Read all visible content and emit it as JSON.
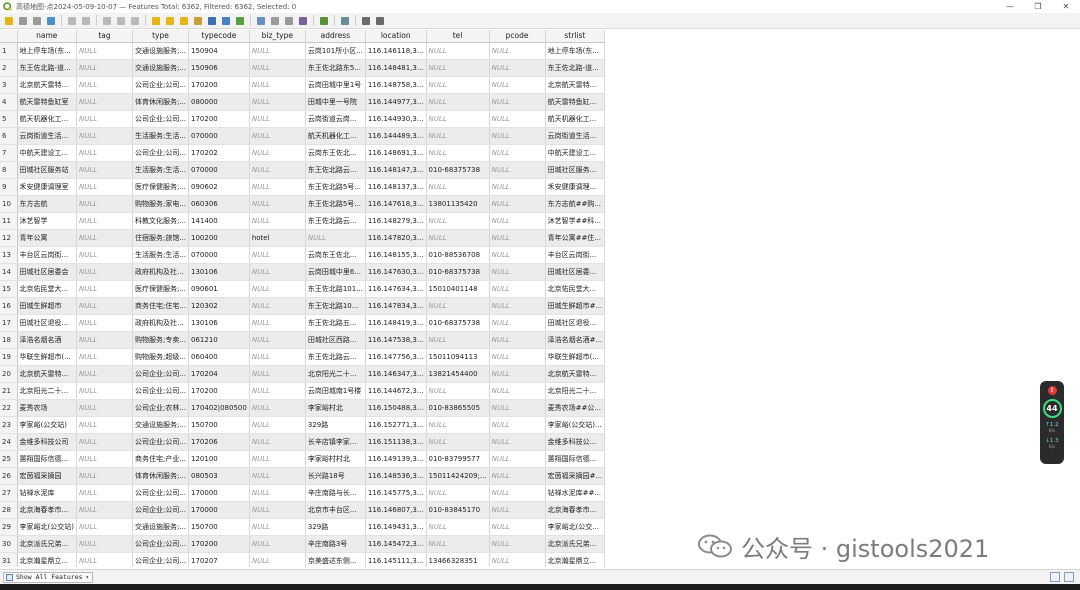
{
  "window": {
    "title": "高德地图-点2024-05-09-10-07 — Features Total: 6362, Filtered: 6362, Selected: 0",
    "min_glyph": "—",
    "max_glyph": "❐",
    "close_glyph": "✕"
  },
  "toolbar": {
    "icons": [
      "toggle-editing-icon",
      "multi-edit-icon",
      "save-edits-icon",
      "reload-icon",
      "add-feature-icon",
      "delete-selected-icon",
      "cut-icon",
      "copy-icon",
      "paste-icon",
      "select-expression-icon",
      "select-all-icon",
      "invert-selection-icon",
      "deselect-icon",
      "filter-select-icon",
      "move-selection-top-icon",
      "pan-to-selection-icon",
      "zoom-to-selection-icon",
      "new-field-icon",
      "delete-field-icon",
      "field-calculator-icon",
      "conditional-formatting-icon",
      "actions-icon",
      "dock-icon",
      "organize-columns-icon"
    ]
  },
  "table": {
    "columns": [
      "name",
      "tag",
      "type",
      "typecode",
      "biz_type",
      "address",
      "location",
      "tel",
      "pcode",
      "strlist"
    ],
    "rows": [
      [
        "1",
        "地上停车场(东...",
        "NULL",
        "交通设施服务;...",
        "150904",
        "NULL",
        "云岗101所小区...",
        "116.146118,3...",
        "NULL",
        "NULL",
        "地上停车场(东..."
      ],
      [
        "2",
        "东王佐北路-道...",
        "NULL",
        "交通设施服务;...",
        "150906",
        "NULL",
        "东王佐北路东5...",
        "116.148481,3...",
        "NULL",
        "NULL",
        "东王佐北路-道..."
      ],
      [
        "3",
        "北京航天雷特...",
        "NULL",
        "公司企业;公司...",
        "170200",
        "NULL",
        "云岗田城中里1号",
        "116.148758,3...",
        "NULL",
        "NULL",
        "北京航天雷特..."
      ],
      [
        "4",
        "航天雷特鱼缸室",
        "NULL",
        "体育休闲服务;...",
        "080000",
        "NULL",
        "田城中里一号院",
        "116.144977,3...",
        "NULL",
        "NULL",
        "航天雷特鱼缸..."
      ],
      [
        "5",
        "航天机器化工...",
        "NULL",
        "公司企业;公司...",
        "170200",
        "NULL",
        "云岗街道云岗...",
        "116.144930,3...",
        "NULL",
        "NULL",
        "航天机器化工..."
      ],
      [
        "6",
        "云岗街道生活...",
        "NULL",
        "生活服务;生活...",
        "070000",
        "NULL",
        "航天机器化工...",
        "116.144489,3...",
        "NULL",
        "NULL",
        "云岗街道生活..."
      ],
      [
        "7",
        "中航天建设工...",
        "NULL",
        "公司企业;公司...",
        "170202",
        "NULL",
        "云岗东王佐北...",
        "116.148691,3...",
        "NULL",
        "NULL",
        "中航天建设工..."
      ],
      [
        "8",
        "田城社区服务站",
        "NULL",
        "生活服务;生活...",
        "070000",
        "NULL",
        "东王佐北路云...",
        "116.148147,3...",
        "010-68375738",
        "NULL",
        "田城社区服务..."
      ],
      [
        "9",
        "禾安健康调理室",
        "NULL",
        "医疗保健服务;...",
        "090602",
        "NULL",
        "东王佐北路5号...",
        "116.148137,3...",
        "NULL",
        "NULL",
        "禾安健康调理..."
      ],
      [
        "10",
        "东方志航",
        "NULL",
        "购物服务;家电...",
        "060306",
        "NULL",
        "东王佐北路5号...",
        "116.147618,3...",
        "13801135420",
        "NULL",
        "东方志航##购..."
      ],
      [
        "11",
        "沐艺智学",
        "NULL",
        "科教文化服务;...",
        "141400",
        "NULL",
        "东王佐北路云...",
        "116.148279,3...",
        "NULL",
        "NULL",
        "沐艺智学##科..."
      ],
      [
        "12",
        "青年公寓",
        "NULL",
        "住宿服务;旅馆...",
        "100200",
        "hotel",
        "NULL",
        "116.147820,3...",
        "NULL",
        "NULL",
        "青年公寓##住..."
      ],
      [
        "13",
        "丰台区云岗街...",
        "NULL",
        "生活服务;生活...",
        "070000",
        "NULL",
        "云岗东王佐北...",
        "116.148155,3...",
        "010-88536708",
        "NULL",
        "丰台区云岗街..."
      ],
      [
        "14",
        "田城社区居委会",
        "NULL",
        "政府机构及社...",
        "130106",
        "NULL",
        "云岗田城中里6...",
        "116.147630,3...",
        "010-68375738",
        "NULL",
        "田城社区居委..."
      ],
      [
        "15",
        "北京佑民堂大...",
        "NULL",
        "医疗保健服务;...",
        "090601",
        "NULL",
        "东王佐北路101...",
        "116.147634,3...",
        "15010401148",
        "NULL",
        "北京佑民堂大..."
      ],
      [
        "16",
        "田城生鲜超市",
        "NULL",
        "商务住宅;住宅...",
        "120302",
        "NULL",
        "东王佐北路10...",
        "116.147834,3...",
        "NULL",
        "NULL",
        "田城生鲜超市#..."
      ],
      [
        "17",
        "田城社区退役...",
        "NULL",
        "政府机构及社...",
        "130106",
        "NULL",
        "东王佐北路五...",
        "116.148419,3...",
        "010-68375738",
        "NULL",
        "田城社区退役..."
      ],
      [
        "18",
        "泽浩名烟名酒",
        "NULL",
        "购物服务;专卖...",
        "061210",
        "NULL",
        "田城社区西路...",
        "116.147538,3...",
        "NULL",
        "NULL",
        "泽浩名烟名酒#..."
      ],
      [
        "19",
        "华联生鲜超市(...",
        "NULL",
        "购物服务;超级...",
        "060400",
        "NULL",
        "东王佐北路云...",
        "116.147756,3...",
        "15011094113",
        "NULL",
        "华联生鲜超市(..."
      ],
      [
        "20",
        "北京航天雷特...",
        "NULL",
        "公司企业;公司...",
        "170204",
        "NULL",
        "北京阳光二十...",
        "116.146347,3...",
        "13821454400",
        "NULL",
        "北京航天雷特..."
      ],
      [
        "21",
        "北京阳光二十...",
        "NULL",
        "公司企业;公司...",
        "170200",
        "NULL",
        "云岗田城南1号楼",
        "116.144672,3...",
        "NULL",
        "NULL",
        "北京阳光二十..."
      ],
      [
        "22",
        "麦秀农场",
        "NULL",
        "公司企业;农林...",
        "170402|080500",
        "NULL",
        "李家峪村北",
        "116.150488,3...",
        "010-83865505",
        "NULL",
        "麦秀农场##公..."
      ],
      [
        "23",
        "李家峪(公交站)",
        "NULL",
        "交通设施服务;...",
        "150700",
        "NULL",
        "329路",
        "116.152771,3...",
        "NULL",
        "NULL",
        "李家峪(公交站)..."
      ],
      [
        "24",
        "金维多科技公司",
        "NULL",
        "公司企业;公司...",
        "170206",
        "NULL",
        "长辛店镇李家...",
        "116.151138,3...",
        "NULL",
        "NULL",
        "金维多科技公..."
      ],
      [
        "25",
        "蕙翔国际信德...",
        "NULL",
        "商务住宅;产业...",
        "120100",
        "NULL",
        "李家峪村村北",
        "116.149139,3...",
        "010-83799577",
        "NULL",
        "蕙翔国际信德..."
      ],
      [
        "26",
        "宏茵福采摘园",
        "NULL",
        "体育休闲服务;...",
        "080503",
        "NULL",
        "长兴路18号",
        "116.148536,3...",
        "15011424209;...",
        "NULL",
        "宏茵福采摘园#..."
      ],
      [
        "27",
        "钻禅水泥库",
        "NULL",
        "公司企业;公司...",
        "170000",
        "NULL",
        "辛庄南路与长...",
        "116.145775,3...",
        "NULL",
        "NULL",
        "钻禅水泥库##..."
      ],
      [
        "28",
        "北京海春孝市...",
        "NULL",
        "公司企业;公司...",
        "170000",
        "NULL",
        "北京市丰台区...",
        "116.146807,3...",
        "010-83845170",
        "NULL",
        "北京海春孝市..."
      ],
      [
        "29",
        "李家峪北(公交站)",
        "NULL",
        "交通设施服务;...",
        "150700",
        "NULL",
        "329路",
        "116.149431,3...",
        "NULL",
        "NULL",
        "李家峪北(公交..."
      ],
      [
        "30",
        "北京派氏兄弟...",
        "NULL",
        "公司企业;公司...",
        "170200",
        "NULL",
        "辛庄南路3号",
        "116.145472,3...",
        "NULL",
        "NULL",
        "北京派氏兄弟..."
      ],
      [
        "31",
        "北京瀚星鼎立...",
        "NULL",
        "公司企业;公司...",
        "170207",
        "NULL",
        "京美盛达东侧...",
        "116.145111,3...",
        "13466328351",
        "NULL",
        "北京瀚星鼎立..."
      ]
    ]
  },
  "statusbar": {
    "show_features_label": "Show All Features"
  },
  "perf_widget": {
    "alert": "!",
    "score": "44",
    "upload_value": "1.2",
    "upload_unit": "K/s",
    "download_value": "1.3",
    "download_unit": "K/s"
  },
  "watermark": {
    "text": "公众号 · gistools2021"
  },
  "colors": {
    "qgis_green": "#589632",
    "null_text": "#9a9a9a",
    "alt_row": "#ececec"
  }
}
